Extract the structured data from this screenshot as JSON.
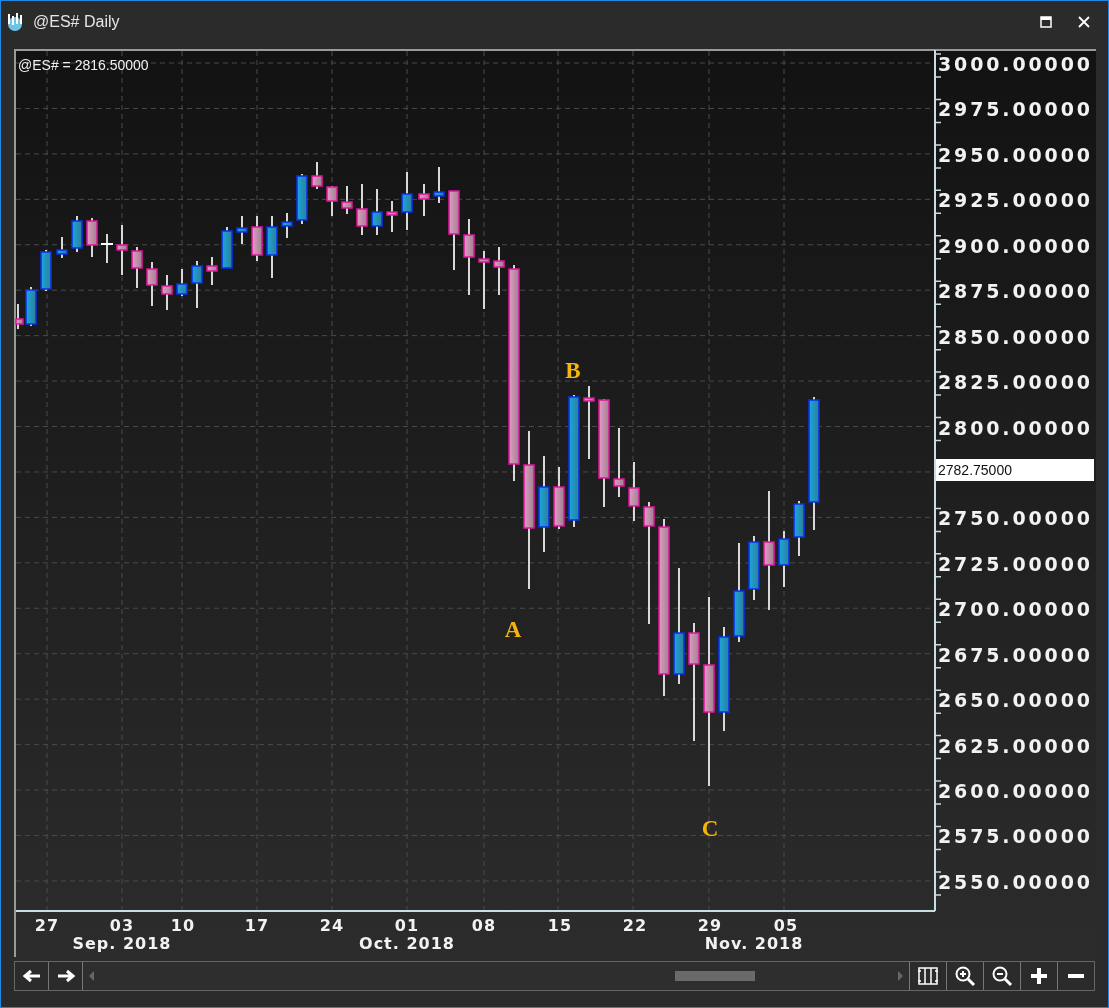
{
  "window": {
    "title": "@ES# Daily"
  },
  "chart": {
    "legend": "@ES# = 2816.50000",
    "price_labels": [
      "3000.00000",
      "2975.00000",
      "2950.00000",
      "2925.00000",
      "2900.00000",
      "2875.00000",
      "2850.00000",
      "2825.00000",
      "2800.00000",
      "2750.00000",
      "2725.00000",
      "2700.00000",
      "2675.00000",
      "2650.00000",
      "2625.00000",
      "2600.00000",
      "2575.00000",
      "2550.00000"
    ],
    "current_price": "2782.75000",
    "wave_labels": [
      "A",
      "B",
      "C"
    ],
    "day_labels": [
      "27",
      "03",
      "10",
      "17",
      "24",
      "01",
      "08",
      "15",
      "22",
      "29",
      "05"
    ],
    "month_labels": [
      "Sep. 2018",
      "Oct. 2018",
      "Nov. 2018"
    ]
  }
}
